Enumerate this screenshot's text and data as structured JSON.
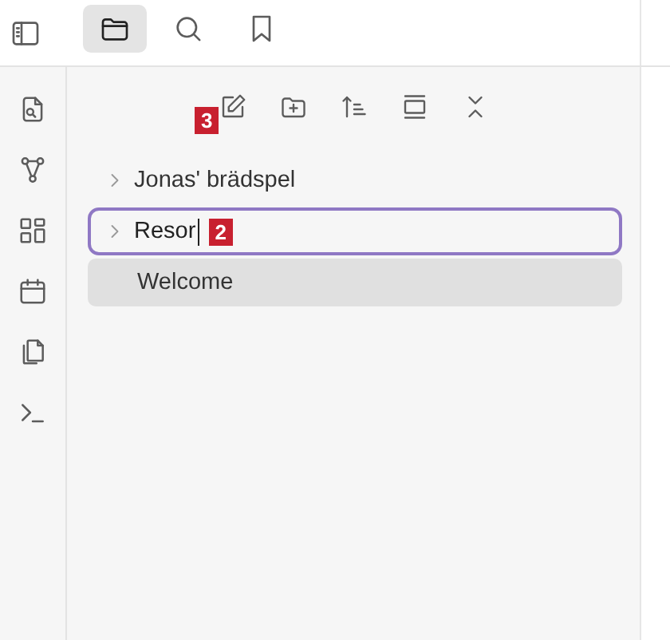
{
  "top_tabs": [
    {
      "kind": "files",
      "selected": true
    },
    {
      "kind": "search",
      "selected": false
    },
    {
      "kind": "bookmarks",
      "selected": false
    }
  ],
  "file_toolbar": {
    "annotation": "3"
  },
  "file_tree": [
    {
      "label": "Jonas' brädspel",
      "kind": "folder",
      "editing": false,
      "selected": false
    },
    {
      "label": "Resor",
      "kind": "folder",
      "editing": true,
      "selected": false,
      "annotation": "2"
    },
    {
      "label": "Welcome",
      "kind": "file",
      "editing": false,
      "selected": true
    }
  ]
}
